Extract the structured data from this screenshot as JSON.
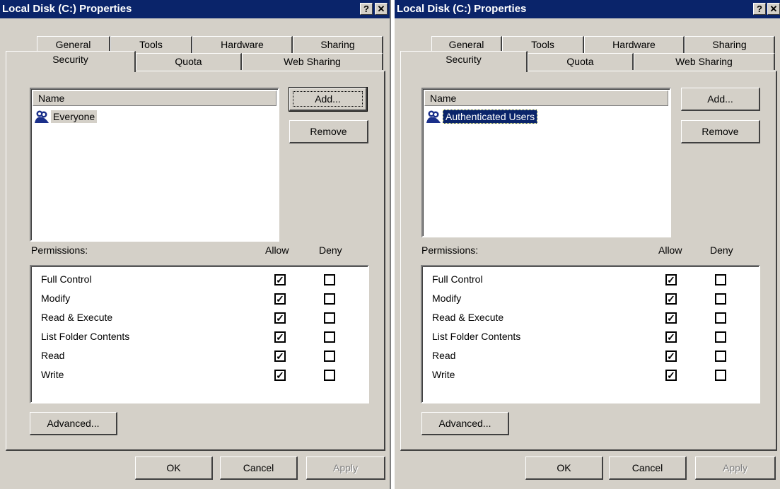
{
  "dialogs": [
    {
      "title": "Local Disk (C:) Properties",
      "help_btn": "?",
      "close_btn": "✕",
      "tabs_row1": [
        "General",
        "Tools",
        "Hardware",
        "Sharing"
      ],
      "tabs_row2": [
        "Security",
        "Quota",
        "Web Sharing"
      ],
      "name_header": "Name",
      "user": "Everyone",
      "add_label": "Add...",
      "remove_label": "Remove",
      "permissions_label": "Permissions:",
      "allow_label": "Allow",
      "deny_label": "Deny",
      "permissions": [
        {
          "name": "Full Control",
          "allow": true,
          "deny": false
        },
        {
          "name": "Modify",
          "allow": true,
          "deny": false
        },
        {
          "name": "Read & Execute",
          "allow": true,
          "deny": false
        },
        {
          "name": "List Folder Contents",
          "allow": true,
          "deny": false
        },
        {
          "name": "Read",
          "allow": true,
          "deny": false
        },
        {
          "name": "Write",
          "allow": true,
          "deny": false
        }
      ],
      "advanced_label": "Advanced...",
      "ok_label": "OK",
      "cancel_label": "Cancel",
      "apply_label": "Apply"
    },
    {
      "title": "Local Disk (C:) Properties",
      "help_btn": "?",
      "close_btn": "✕",
      "tabs_row1": [
        "General",
        "Tools",
        "Hardware",
        "Sharing"
      ],
      "tabs_row2": [
        "Security",
        "Quota",
        "Web Sharing"
      ],
      "name_header": "Name",
      "user": "Authenticated Users",
      "add_label": "Add...",
      "remove_label": "Remove",
      "permissions_label": "Permissions:",
      "allow_label": "Allow",
      "deny_label": "Deny",
      "permissions": [
        {
          "name": "Full Control",
          "allow": true,
          "deny": false
        },
        {
          "name": "Modify",
          "allow": true,
          "deny": false
        },
        {
          "name": "Read & Execute",
          "allow": true,
          "deny": false
        },
        {
          "name": "List Folder Contents",
          "allow": true,
          "deny": false
        },
        {
          "name": "Read",
          "allow": true,
          "deny": false
        },
        {
          "name": "Write",
          "allow": true,
          "deny": false
        }
      ],
      "advanced_label": "Advanced...",
      "ok_label": "OK",
      "cancel_label": "Cancel",
      "apply_label": "Apply"
    }
  ],
  "icons": {
    "user_group": "users-group-icon",
    "check": "✓"
  },
  "colors": {
    "titlebar": "#0a246a",
    "face": "#d4d0c8",
    "selection": "#0a246a"
  }
}
